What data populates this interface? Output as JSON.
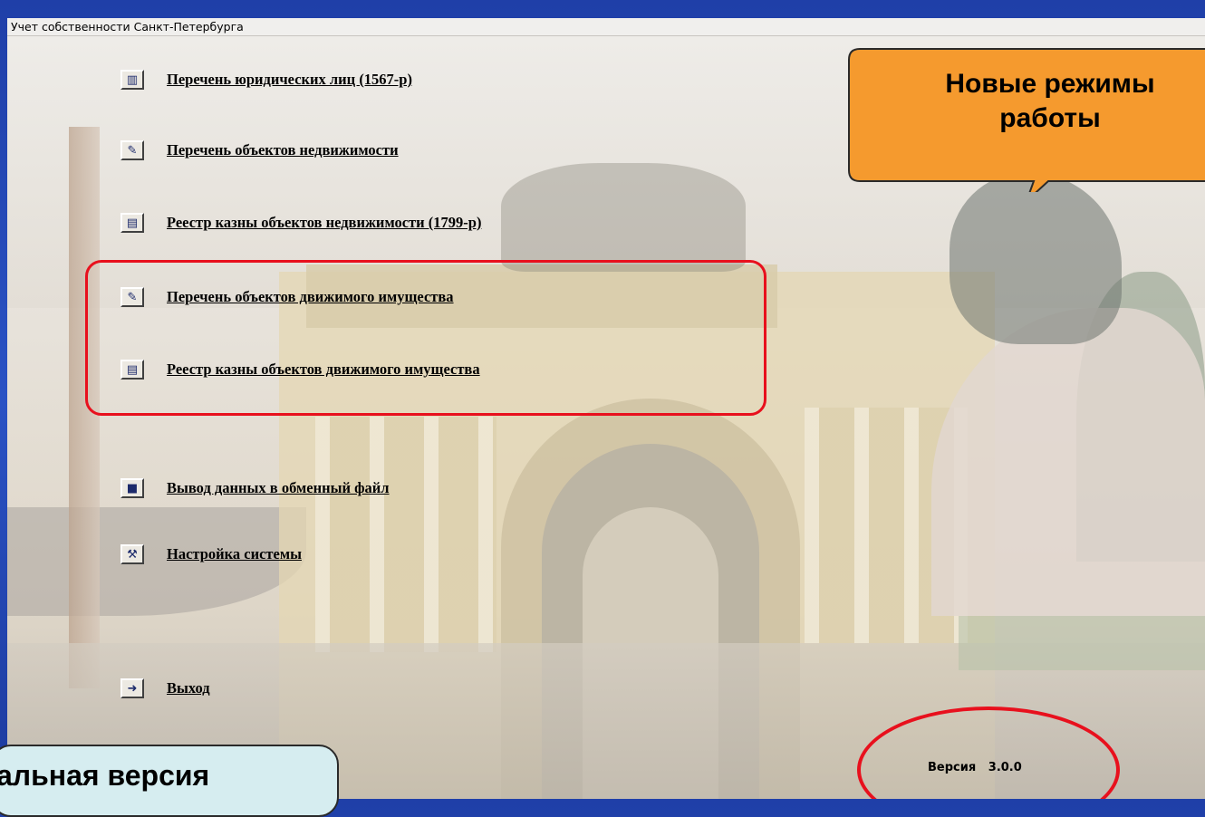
{
  "window": {
    "title": "Учет собственности Санкт-Петербурга"
  },
  "menu": {
    "items": [
      {
        "label": "Перечень юридических лиц (1567-р)",
        "icon": "entity-list-icon",
        "glyph": "▥"
      },
      {
        "label": "Перечень объектов недвижимости",
        "icon": "form-list-icon",
        "glyph": "✎"
      },
      {
        "label": "Реестр казны объектов недвижимости (1799-р)",
        "icon": "report-icon",
        "glyph": "▤"
      },
      {
        "label": "Перечень объектов движимого имущества",
        "icon": "form-list-icon",
        "glyph": "✎"
      },
      {
        "label": "Реестр казны объектов движимого имущества",
        "icon": "report-icon",
        "glyph": "▤"
      },
      {
        "label": "Вывод данных в обменный файл",
        "icon": "save-disk-icon",
        "glyph": "■"
      },
      {
        "label": "Настройка системы",
        "icon": "tools-icon",
        "glyph": "⚒"
      },
      {
        "label": "Выход",
        "icon": "exit-door-icon",
        "glyph": "➜"
      }
    ]
  },
  "version": {
    "text": "Версия   3.0.0"
  },
  "callouts": {
    "new_modes": {
      "line1": "Новые режимы",
      "line2": "работы"
    },
    "demo": {
      "text": "альная версия"
    }
  },
  "colors": {
    "desktop_blue": "#2a52c4",
    "highlight_red": "#e8101d",
    "callout_orange": "#f59a2e",
    "callout_blue": "#d6edf0"
  }
}
